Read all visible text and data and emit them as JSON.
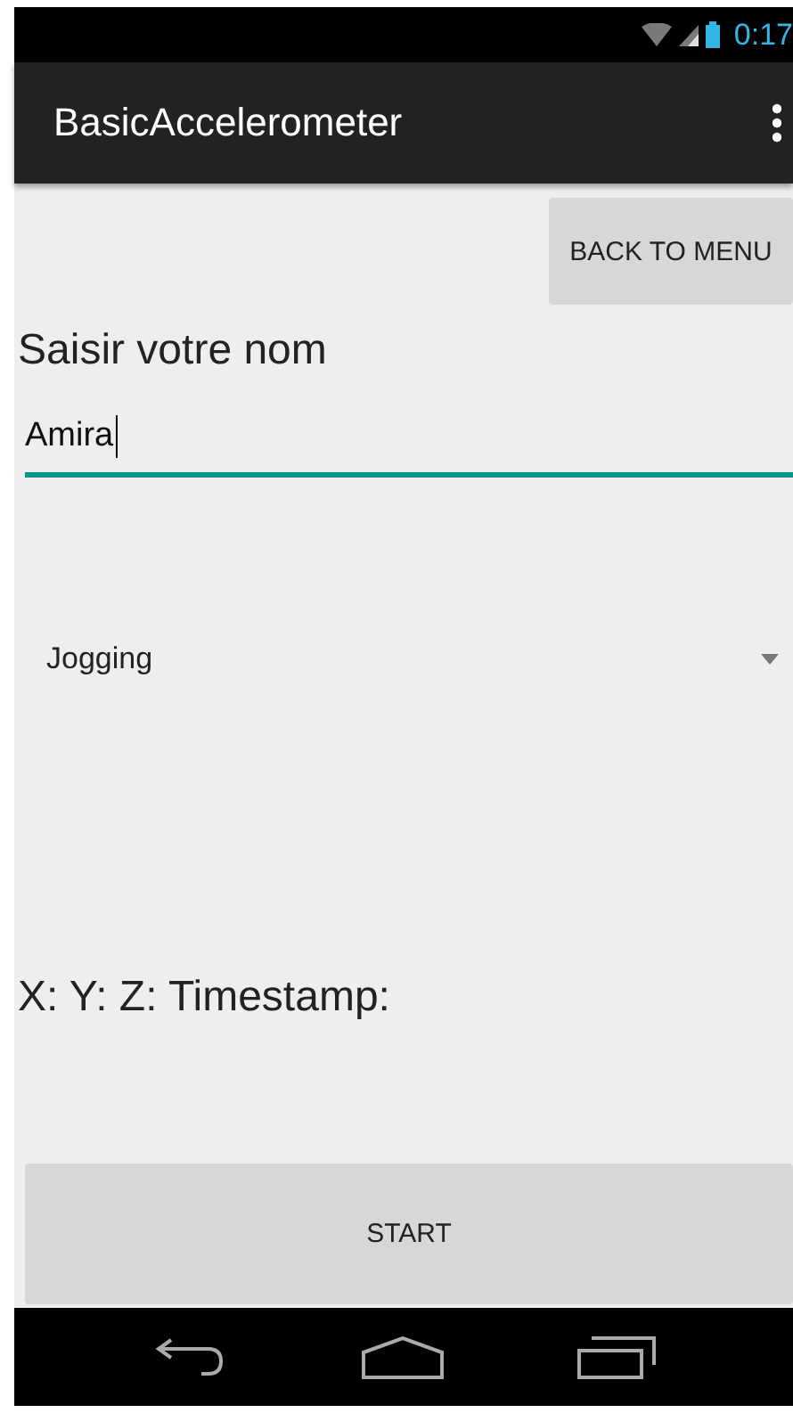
{
  "status_bar": {
    "time": "0:17"
  },
  "action_bar": {
    "title": "BasicAccelerometer"
  },
  "back_button": {
    "label": "BACK TO MENU"
  },
  "name_label": "Saisir votre nom",
  "name_field": {
    "value": "Amira",
    "focused": true
  },
  "activity_spinner": {
    "value": "Jogging"
  },
  "readings": "X: Y: Z: Timestamp:",
  "start_button": {
    "label": "START"
  }
}
